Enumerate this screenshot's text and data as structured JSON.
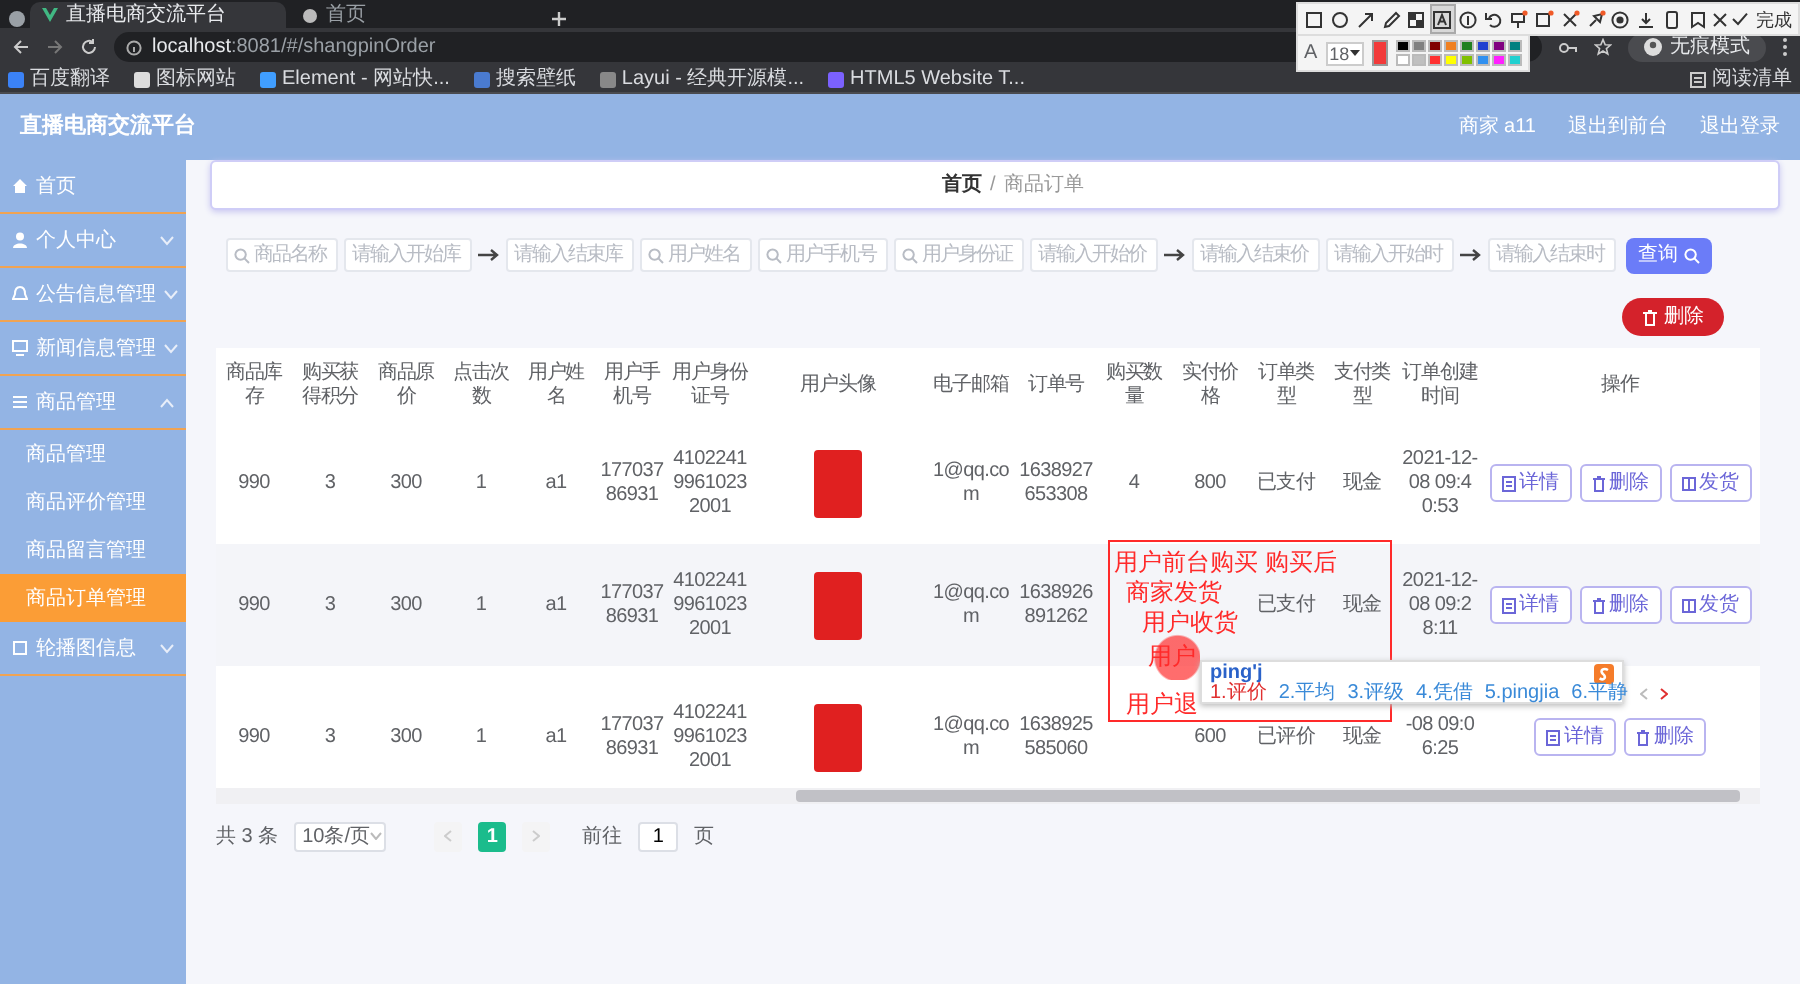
{
  "browser": {
    "tabs": [
      {
        "title": "直播电商交流平台",
        "selected": true
      },
      {
        "title": "首页",
        "selected": false
      }
    ],
    "address": "**localhost**:8081/#/shangpinOrder",
    "bookmarks": [
      "百度翻译",
      "图标网站",
      "Element - 网站快...",
      "搜索壁纸",
      "Layui - 经典开源模...",
      "HTML5 Website T..."
    ],
    "profile": "无痕模式",
    "reading_list": "阅读清单"
  },
  "capture_toolbar": {
    "tools": [
      {
        "selected": false
      },
      {
        "selected": false
      },
      {
        "selected": false
      },
      {
        "selected": false
      },
      {
        "selected": false
      },
      {
        "selected": true
      },
      {
        "selected": false
      },
      {
        "selected": false
      },
      {
        "selected": false
      },
      {
        "selected": false
      },
      {
        "selected": false
      },
      {
        "selected": false
      },
      {
        "selected": false
      },
      {
        "selected": false
      },
      {
        "selected": false
      },
      {
        "selected": false
      }
    ],
    "done": "完成",
    "text_label": "A",
    "font_size": "18",
    "palette": [
      {
        "color": "#000000"
      },
      {
        "color": "#808080"
      },
      {
        "color": "#800000"
      },
      {
        "color": "#f08020"
      },
      {
        "color": "#208020"
      },
      {
        "color": "#2040d0"
      },
      {
        "color": "#800080"
      },
      {
        "color": "#008080"
      },
      {
        "color": "#ffffff"
      },
      {
        "color": "#c0c0c0"
      },
      {
        "color": "#ff3030"
      },
      {
        "color": "#ffff00"
      },
      {
        "color": "#80c000"
      },
      {
        "color": "#3090f0"
      },
      {
        "color": "#ff20ff"
      },
      {
        "color": "#20d0d0"
      }
    ]
  },
  "app": {
    "title": "直播电商交流平台",
    "user": "商家 a11",
    "links": [
      "退出到前台",
      "退出登录"
    ]
  },
  "sidebar": {
    "items": [
      {
        "label": "首页",
        "selected": false
      },
      {
        "label": "个人中心",
        "expanded": false,
        "selected": false
      },
      {
        "label": "公告信息管理",
        "expanded": false,
        "selected": false
      },
      {
        "label": "新闻信息管理",
        "expanded": false,
        "selected": false
      },
      {
        "label": "商品管理",
        "expanded": true,
        "selected": false,
        "children": [
          {
            "label": "商品管理",
            "selected": false
          },
          {
            "label": "商品评价管理",
            "selected": false
          },
          {
            "label": "商品留言管理",
            "selected": false
          },
          {
            "label": "商品订单管理",
            "selected": true
          }
        ]
      },
      {
        "label": "轮播图信息",
        "expanded": false,
        "selected": false
      }
    ]
  },
  "breadcrumb": {
    "items": [
      "首页",
      "商品订单"
    ],
    "separator": "/"
  },
  "filters": [
    {
      "kind": "search",
      "placeholder": "商品名称"
    },
    {
      "kind": "plain",
      "placeholder": "请输入开始库"
    },
    {
      "kind": "arrow"
    },
    {
      "kind": "plain",
      "placeholder": "请输入结束库"
    },
    {
      "kind": "search",
      "placeholder": "用户姓名"
    },
    {
      "kind": "search",
      "placeholder": "用户手机号"
    },
    {
      "kind": "search",
      "placeholder": "用户身份证"
    },
    {
      "kind": "plain",
      "placeholder": "请输入开始价"
    },
    {
      "kind": "arrow"
    },
    {
      "kind": "plain",
      "placeholder": "请输入结束价"
    },
    {
      "kind": "plain",
      "placeholder": "请输入开始时"
    },
    {
      "kind": "arrow"
    },
    {
      "kind": "plain",
      "placeholder": "请输入结束时"
    }
  ],
  "search_button": "查询",
  "delete_button": "删除",
  "table": {
    "columns": [
      {
        "label": "商品库存"
      },
      {
        "label": "购买获得积分"
      },
      {
        "label": "商品原价"
      },
      {
        "label": "点击次数"
      },
      {
        "label": "用户姓名"
      },
      {
        "label": "用户手机号"
      },
      {
        "label": "用户身份证号"
      },
      {
        "label": "用户头像",
        "kind": "image"
      },
      {
        "label": "电子邮箱"
      },
      {
        "label": "订单号"
      },
      {
        "label": "购买数量"
      },
      {
        "label": "实付价格"
      },
      {
        "label": "订单类型"
      },
      {
        "label": "支付类型"
      },
      {
        "label": "订单创建时间"
      },
      {
        "label": "操作",
        "kind": "actions"
      }
    ],
    "rows": [
      {
        "cells": [
          "990",
          "3",
          "300",
          "1",
          "a1",
          "17703786931",
          "410224199610232001",
          "",
          "1@qq.com",
          "1638927653308",
          "4",
          "800",
          "已支付",
          "现金",
          "2021-12-08 09:40:53"
        ],
        "actions": [
          "详情",
          "删除",
          "发货"
        ]
      },
      {
        "cells": [
          "990",
          "3",
          "300",
          "1",
          "a1",
          "17703786931",
          "410224199610232001",
          "",
          "1@qq.com",
          "1638926891262",
          "",
          "",
          "已支付",
          "现金",
          "2021-12-08 09:28:11"
        ],
        "actions": [
          "详情",
          "删除",
          "发货"
        ]
      },
      {
        "cells": [
          "990",
          "3",
          "300",
          "1",
          "a1",
          "17703786931",
          "410224199610232001",
          "",
          "1@qq.com",
          "1638925585060",
          "",
          "600",
          "已评价",
          "现金",
          "-08 09:06:25"
        ],
        "actions": [
          "详情",
          "删除"
        ]
      }
    ]
  },
  "pagination": {
    "total": "共 3 条",
    "page_size": "10条/页",
    "pages": [
      {
        "label": "1",
        "selected": true
      }
    ],
    "goto_label": "前往",
    "goto_value": "1",
    "goto_suffix": "页"
  },
  "annotation": {
    "lines": [
      "用户前台购买  购买后",
      "商家发货",
      "用户收货",
      "用户",
      "用户退"
    ]
  },
  "ime": {
    "input": "ping'j",
    "candidates": [
      "1.评价",
      "2.平均",
      "3.评级",
      "4.凭借",
      "5.pingjia",
      "6.平静"
    ]
  }
}
